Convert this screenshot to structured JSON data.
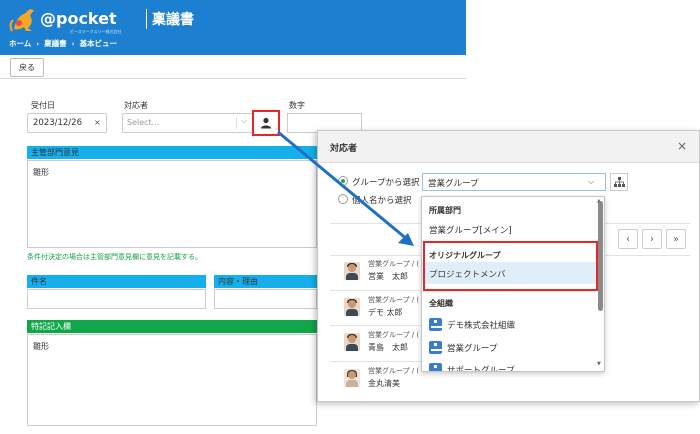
{
  "header": {
    "logo_text": "@pocket",
    "logo_sub": "ピースマークスリー株式会社",
    "title": "稟議書",
    "breadcrumb": [
      "ホーム",
      "稟議書",
      "基本ビュー"
    ]
  },
  "toolbar": {
    "back_label": "戻る"
  },
  "form": {
    "received_date_label": "受付日",
    "received_date_value": "2023/12/26",
    "date_clear": "×",
    "handler_label": "対応者",
    "handler_placeholder": "Select...",
    "number_label": "数字",
    "dept_opinion_label": "主管部門意見",
    "dept_opinion_value": "雛形",
    "note": "条件付決定の場合は主管部門意見欄に意見を記載する。",
    "subject_label": "件名",
    "reason_label": "内容・理由",
    "remarks_label": "特記記入欄",
    "remarks_value": "雛形"
  },
  "dialog": {
    "title": "対応者",
    "close": "×",
    "group_radio_label": "グループから選択",
    "person_radio_label": "個人名から選択",
    "group_select_value": "営業グループ",
    "pager": [
      "‹",
      "›",
      "»"
    ],
    "users": [
      {
        "group": "営業グループ / (",
        "name": "営業　太郎"
      },
      {
        "group": "営業グループ / (",
        "name": "デモ 太郎"
      },
      {
        "group": "営業グループ / (",
        "name": "青島　太郎"
      },
      {
        "group": "営業グループ / (",
        "name": "金丸清美"
      }
    ]
  },
  "dropdown": {
    "section_affiliation": "所属部門",
    "item_main": "営業グループ[メイン]",
    "section_original": "オリジナルグループ",
    "item_project": "プロジェクトメンバ",
    "section_all": "全組織",
    "org_items": [
      "デモ株式会社組織",
      "営業グループ",
      "サポートグループ"
    ]
  },
  "colors": {
    "header_blue": "#1c7fd0",
    "section_blue": "#15b0ec",
    "section_green": "#10a74a",
    "highlight_red": "#e5262a",
    "arrow_blue": "#1f6fc4"
  }
}
